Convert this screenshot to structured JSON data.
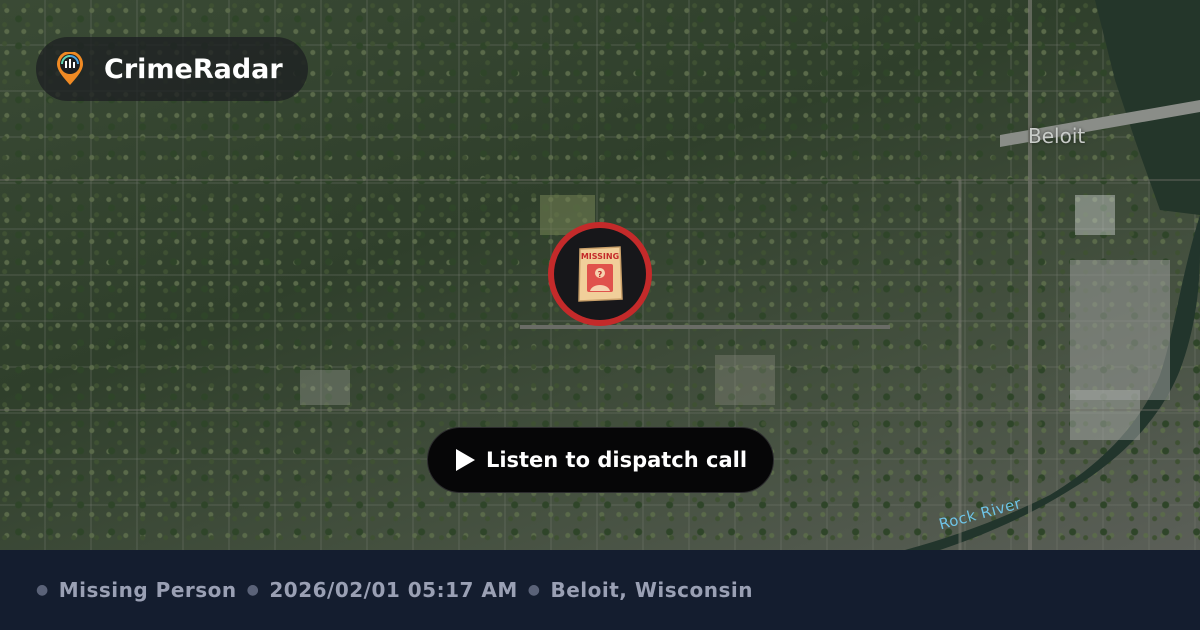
{
  "brand": {
    "name": "CrimeRadar",
    "logo_icon": "radar-pin-icon"
  },
  "map": {
    "place_label": "Beloit",
    "river_label": "Rock River"
  },
  "marker": {
    "icon": "missing-poster-icon",
    "poster_text": "MISSING",
    "ring_color": "#c42a2a"
  },
  "action": {
    "label": "Listen to dispatch call",
    "icon": "play-icon"
  },
  "incident": {
    "type": "Missing Person",
    "datetime": "2026/02/01 05:17 AM",
    "location": "Beloit, Wisconsin"
  }
}
